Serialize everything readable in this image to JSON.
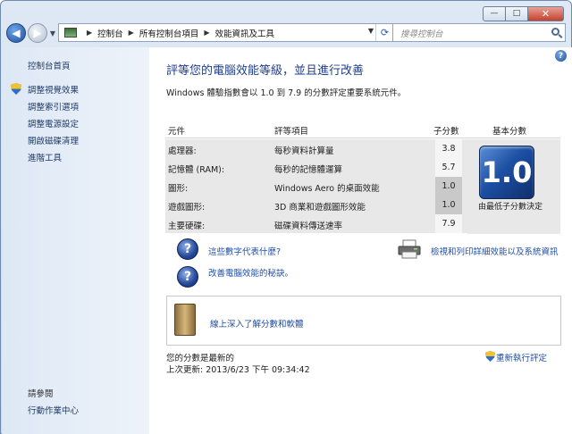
{
  "window": {
    "caption": {
      "minimize": "—",
      "maximize": "□",
      "close": "✕"
    }
  },
  "address_bar": {
    "crumbs": [
      "控制台",
      "所有控制台項目",
      "效能資訊及工具"
    ]
  },
  "search": {
    "placeholder": "搜尋控制台"
  },
  "sidebar": {
    "home": "控制台首頁",
    "items": [
      "調整視覺效果",
      "調整索引選項",
      "調整電源設定",
      "開啟磁碟清理",
      "進階工具"
    ],
    "see_also": "請參閱",
    "action_center": "行動作業中心"
  },
  "main": {
    "title": "評等您的電腦效能等級，並且進行改善",
    "description": "Windows 體驗指數會以 1.0 到 7.9 的分數評定重要系統元件。",
    "table": {
      "headers": {
        "component": "元件",
        "item": "評等項目",
        "subscore": "子分數",
        "base": "基本分數"
      },
      "rows": [
        {
          "component": "處理器:",
          "item": "每秒資料計算量",
          "score": "3.8"
        },
        {
          "component": "記憶體 (RAM):",
          "item": "每秒的記憶體運算",
          "score": "5.7"
        },
        {
          "component": "圖形:",
          "item": "Windows Aero 的桌面效能",
          "score": "1.0"
        },
        {
          "component": "遊戲圖形:",
          "item": "3D 商業和遊戲圖形效能",
          "score": "1.0"
        },
        {
          "component": "主要硬碟:",
          "item": "磁碟資料傳送速率",
          "score": "7.9"
        }
      ],
      "base_score": "1.0",
      "base_caption": "由最低子分數決定"
    },
    "links": {
      "what_numbers_mean": "這些數字代表什麼?",
      "improve_tips": "改善電腦效能的秘訣。",
      "print_details": "檢視和列印詳細效能以及系統資訊",
      "learn_online": "線上深入了解分數和軟體"
    },
    "status": {
      "current": "您的分數是最新的",
      "last_update": "上次更新: 2013/6/23 下午 09:34:42",
      "rerun": "重新執行評定"
    }
  }
}
